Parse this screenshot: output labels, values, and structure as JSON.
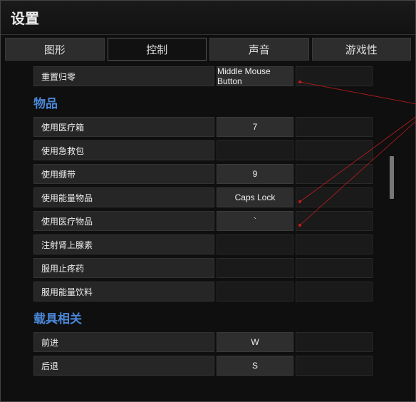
{
  "window_title": "设置",
  "tabs": [
    "图形",
    "控制",
    "声音",
    "游戏性"
  ],
  "active_tab_index": 1,
  "row0": {
    "label": "重置归零",
    "primary": "Middle Mouse Button",
    "secondary": ""
  },
  "section_items": "物品",
  "items_rows": [
    {
      "label": "使用医疗箱",
      "primary": "7",
      "secondary": ""
    },
    {
      "label": "使用急救包",
      "primary": "",
      "secondary": ""
    },
    {
      "label": "使用绷带",
      "primary": "9",
      "secondary": ""
    },
    {
      "label": "使用能量物品",
      "primary": "Caps Lock",
      "secondary": ""
    },
    {
      "label": "使用医疗物品",
      "primary": "`",
      "secondary": ""
    },
    {
      "label": "注射肾上腺素",
      "primary": "",
      "secondary": ""
    },
    {
      "label": "服用止疼药",
      "primary": "",
      "secondary": ""
    },
    {
      "label": "服用能量饮料",
      "primary": "",
      "secondary": ""
    }
  ],
  "section_vehicle": "载具相关",
  "vehicle_rows": [
    {
      "label": "前进",
      "primary": "W",
      "secondary": ""
    },
    {
      "label": "后退",
      "primary": "S",
      "secondary": ""
    }
  ]
}
